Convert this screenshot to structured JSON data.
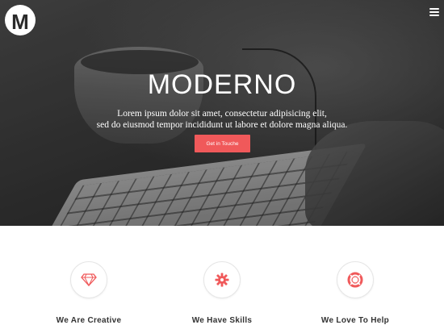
{
  "header": {
    "logo_letter": "M",
    "menu_icon": "hamburger-menu-icon"
  },
  "hero": {
    "title": "MODERNO",
    "text_line1": "Lorem ipsum dolor sit amet, consectetur adipisicing elit,",
    "text_line2": "sed do eiusmod tempor incididunt ut labore et dolore magna aliqua.",
    "cta_label": "Get in Touche"
  },
  "features": [
    {
      "icon": "diamond-icon",
      "title": "We Are Creative"
    },
    {
      "icon": "gear-icon",
      "title": "We Have Skills"
    },
    {
      "icon": "lifebuoy-icon",
      "title": "We Love To Help"
    }
  ],
  "colors": {
    "accent": "#f0595a",
    "hero_text": "#ffffff",
    "feature_title": "#333333"
  }
}
